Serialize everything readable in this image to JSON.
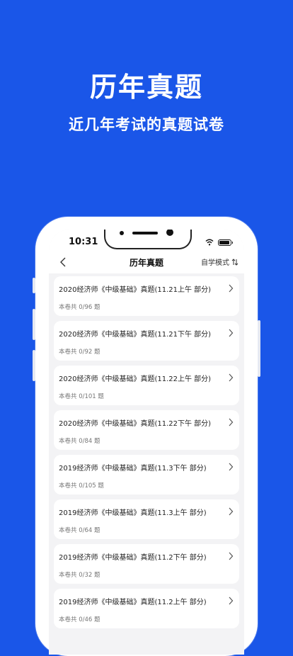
{
  "hero": {
    "title": "历年真题",
    "subtitle": "近几年考试的真题试卷"
  },
  "status_bar": {
    "time": "10:31"
  },
  "nav": {
    "title": "历年真题",
    "mode_label": "自学模式"
  },
  "papers": [
    {
      "title": "2020经济师《中级基础》真题(11.21上午 部分)",
      "meta": "本卷共 0/96 题"
    },
    {
      "title": "2020经济师《中级基础》真题(11.21下午 部分)",
      "meta": "本卷共 0/92 题"
    },
    {
      "title": "2020经济师《中级基础》真题(11.22上午 部分)",
      "meta": "本卷共 0/101 题"
    },
    {
      "title": "2020经济师《中级基础》真题(11.22下午 部分)",
      "meta": "本卷共 0/84 题"
    },
    {
      "title": "2019经济师《中级基础》真题(11.3下午 部分)",
      "meta": "本卷共 0/105 题"
    },
    {
      "title": "2019经济师《中级基础》真题(11.3上午 部分)",
      "meta": "本卷共 0/64 题"
    },
    {
      "title": "2019经济师《中级基础》真题(11.2下午 部分)",
      "meta": "本卷共 0/32 题"
    },
    {
      "title": "2019经济师《中级基础》真题(11.2上午 部分)",
      "meta": "本卷共 0/46 题"
    }
  ]
}
